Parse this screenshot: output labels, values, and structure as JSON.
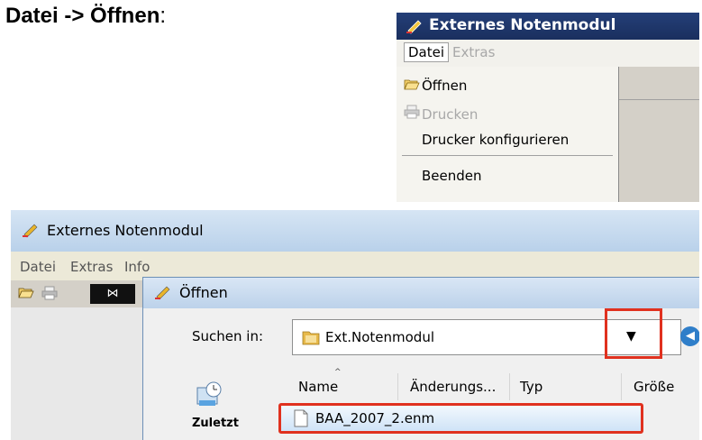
{
  "heading": {
    "text": "Datei -> Öffnen",
    "suffix": ":"
  },
  "top_window": {
    "title": "Externes Notenmodul",
    "menu": [
      {
        "label": "Datei",
        "state": "open"
      },
      {
        "label": "Extras",
        "state": "disabled"
      }
    ],
    "dropdown": [
      {
        "label": "Öffnen",
        "icon": "folder-open-icon",
        "enabled": true
      },
      {
        "label": "Drucken",
        "icon": "printer-icon",
        "enabled": false
      },
      {
        "label": "Drucker konfigurieren",
        "enabled": true
      },
      {
        "label": "Beenden",
        "enabled": true
      }
    ]
  },
  "bottom_window": {
    "title": "Externes Notenmodul",
    "menu": [
      "Datei",
      "Extras",
      "Info"
    ],
    "dialog": {
      "title": "Öffnen",
      "look_in_label": "Suchen in:",
      "look_in_value": "Ext.Notenmodul",
      "places": [
        "Zuletzt"
      ],
      "columns": [
        "Name",
        "Änderungs...",
        "Typ",
        "Größe"
      ],
      "files": [
        "BAA_2007_2.enm"
      ]
    }
  },
  "colors": {
    "highlight": "#e0311f",
    "title_dark": "#1a2f5e"
  }
}
